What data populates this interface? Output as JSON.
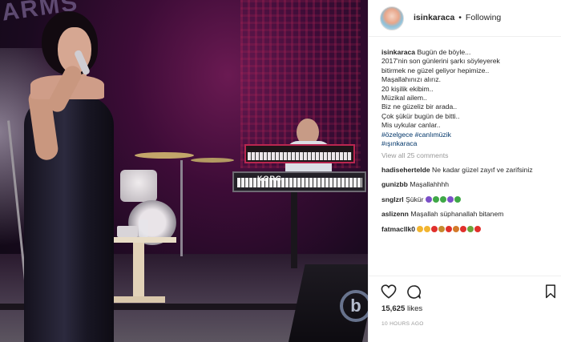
{
  "post": {
    "username": "isinkaraca",
    "separator": "•",
    "follow_status": "Following",
    "caption_user": "isinkaraca",
    "caption_lines": [
      "Bugün de böyle...",
      "2017'nin son günlerini şarkı söyleyerek",
      "bitirmek ne güzel geliyor hepimize..",
      "Maşallahınızı alırız.",
      "20 kişilik ekibim..",
      "Müzikal ailem..",
      "Biz ne güzeliz bir arada..",
      "Çok şükür bugün de bitti..",
      "Mis uykular canlar.."
    ],
    "hashtags_line1": "#özelgece #canlımüzik",
    "hashtags_line2": "#ışınkaraca",
    "view_all": "View all 25 comments",
    "likes_count": "15,625",
    "likes_label": "likes",
    "timestamp": "10 HOURS AGO"
  },
  "comments": [
    {
      "user": "hadisehertelde",
      "text": "Ne kadar güzel zayıf ve zarifsiniz"
    },
    {
      "user": "gunizbb",
      "text": "Maşallahhhh"
    },
    {
      "user": "snglzrl",
      "text": "Şükür",
      "emojis": [
        "#7b4fc8",
        "#3fa847",
        "#3fa847",
        "#7b4fc8",
        "#3fa847"
      ]
    },
    {
      "user": "aslizenn",
      "text": "Maşallah süphanallah bitanem"
    },
    {
      "user": "fatmacllk0",
      "text": "",
      "emojis": [
        "#f2b531",
        "#f2b531",
        "#e0302c",
        "#c58a2e",
        "#e0302c",
        "#d47a2a",
        "#e0302c",
        "#6aa43a",
        "#e0302c"
      ]
    }
  ],
  "photo": {
    "sign_text": "ARMS",
    "keyboard_brand": "KORG",
    "watermark": "b"
  },
  "icons": {
    "heart": "heart-icon",
    "comment": "comment-icon",
    "bookmark": "bookmark-icon"
  }
}
